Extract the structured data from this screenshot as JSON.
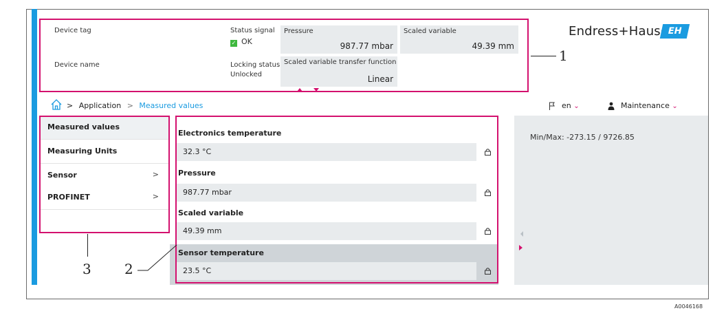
{
  "header": {
    "device_tag_label": "Device tag",
    "device_name_label": "Device name",
    "status_signal_label": "Status signal",
    "status_signal_value": "OK",
    "locking_status_label": "Locking status",
    "locking_status_value": "Unlocked",
    "tiles": [
      {
        "label": "Pressure",
        "value": "987.77 mbar"
      },
      {
        "label": "Scaled variable",
        "value": "49.39 mm"
      },
      {
        "label": "Scaled variable transfer function",
        "value": "Linear"
      }
    ]
  },
  "brand": {
    "name": "Endress+Hauser",
    "logo_text": "EH",
    "logo_color": "#1a9be0"
  },
  "breadcrumb": {
    "items": [
      "Application",
      "Measured values"
    ],
    "separator": ">"
  },
  "topbar": {
    "language": "en",
    "user_role": "Maintenance"
  },
  "sidebar": {
    "items": [
      {
        "label": "Measured values",
        "active": true,
        "has_submenu": false
      },
      {
        "label": "Measuring Units",
        "active": false,
        "has_submenu": false
      },
      {
        "label": "Sensor",
        "active": false,
        "has_submenu": true
      },
      {
        "label": "PROFINET",
        "active": false,
        "has_submenu": true
      }
    ],
    "submenu_arrow": ">"
  },
  "parameters": [
    {
      "label": "Electronics temperature",
      "value": "32.3 °C"
    },
    {
      "label": "Pressure",
      "value": "987.77 mbar"
    },
    {
      "label": "Scaled variable",
      "value": "49.39 mm"
    },
    {
      "label": "Sensor temperature",
      "value": "23.5 °C"
    }
  ],
  "info_panel": {
    "text": "Min/Max: -273.15 / 9726.85"
  },
  "callouts": [
    "1",
    "2",
    "3"
  ],
  "figure_id": "A0046168",
  "colors": {
    "accent": "#1a9be0",
    "highlight": "#d3106e",
    "panel_bg": "#e8ebed"
  }
}
